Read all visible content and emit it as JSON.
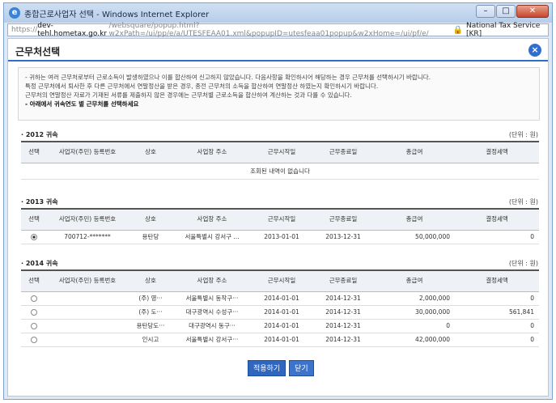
{
  "window": {
    "title": "종합근로사업자 선택 - Windows Internet Explorer",
    "url_prefix": "https://",
    "url_host": "dev-tehl.hometax.go.kr",
    "url_path": "/websquare/popup.html?w2xPath=/ui/pp/e/a/UTESFEAA01.xml&popupID=utesfeaa01popup&w2xHome=/ui/pf/e/",
    "site_label": "National Tax Service [KR]"
  },
  "dialog": {
    "title": "근무처선택",
    "notice_lines": [
      "- 귀하는 여러 근무처로부터 근로소득이 발생하였으나 이를 합산하여 신고하지 않았습니다. 다음사항을 확인하시어 해당하는 경우 근무처를 선택하시기 바랍니다.",
      "  특정 근무처에서 퇴사한 후 다른 근무처에서 연말정산을 받은 경우, 종전 근무처의 소득을 합산하여 연말정산 하였는지 확인하시기 바랍니다.",
      "  근무처의 연말정산 자료가 기재된 서류를 제출하지 않은 경우에는 근무처별 근로소득을 합산하여 계산하는 것과 다를 수 있습니다."
    ],
    "notice_emphasis": "- 아래에서 귀속연도 별 근무처를 선택하세요",
    "unit_label": "(단위 : 원)",
    "columns": [
      "선택",
      "사업자(주민) 등록번호",
      "상호",
      "사업장 주소",
      "근무시작일",
      "근무종료일",
      "총급여",
      "결정세액"
    ],
    "sections": [
      {
        "title": "· 2012 귀속",
        "empty_message": "조회된 내역이 없습니다",
        "rows": []
      },
      {
        "title": "· 2013 귀속",
        "rows": [
          {
            "selected": true,
            "reg_no": "700712-*******",
            "name": "용탄당",
            "address": "서울특별시 강서구 ...",
            "start": "2013-01-01",
            "end": "2013-12-31",
            "total_pay": "50,000,000",
            "tax": "0"
          }
        ]
      },
      {
        "title": "· 2014 귀속",
        "rows": [
          {
            "selected": false,
            "reg_no": "",
            "name": "(주) 영···",
            "address": "서울특별시 동작구···",
            "start": "2014-01-01",
            "end": "2014-12-31",
            "total_pay": "2,000,000",
            "tax": "0"
          },
          {
            "selected": false,
            "reg_no": "",
            "name": "(주) 도···",
            "address": "대구광역시 수성구···",
            "start": "2014-01-01",
            "end": "2014-12-31",
            "total_pay": "30,000,000",
            "tax": "561,841"
          },
          {
            "selected": false,
            "reg_no": "",
            "name": "용탄당도···",
            "address": "대구광역시 동구···",
            "start": "2014-01-01",
            "end": "2014-12-31",
            "total_pay": "0",
            "tax": "0"
          },
          {
            "selected": false,
            "reg_no": "",
            "name": "인시고",
            "address": "서울특별시 강서구···",
            "start": "2014-01-01",
            "end": "2014-12-31",
            "total_pay": "42,000,000",
            "tax": "0"
          }
        ]
      }
    ],
    "buttons": {
      "apply": "적용하기",
      "close": "닫기"
    }
  }
}
